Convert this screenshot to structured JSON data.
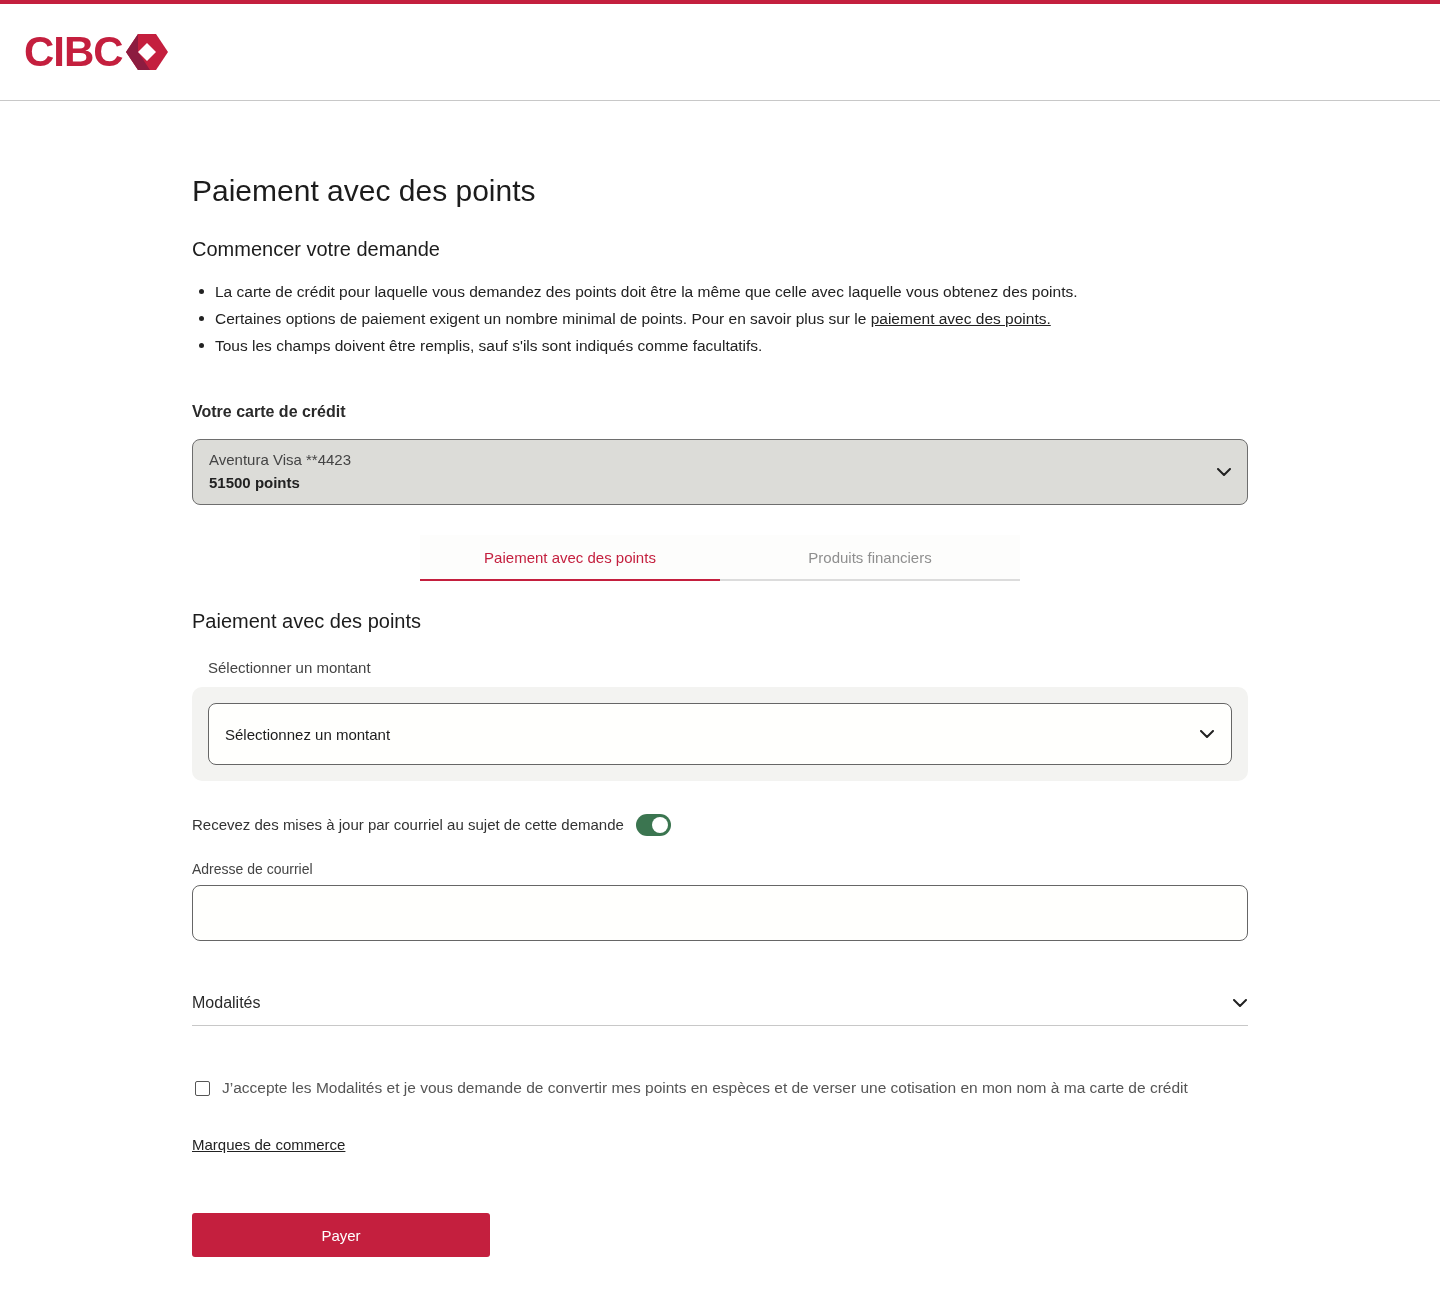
{
  "header": {
    "logo": "CIBC"
  },
  "page_title": "Paiement avec des points",
  "intro": {
    "heading": "Commencer votre demande",
    "bullets": [
      {
        "text": "La carte de crédit pour laquelle vous demandez des points doit être la même que celle avec laquelle vous obtenez des points."
      },
      {
        "text": "Certaines options de paiement exigent un nombre minimal de points. Pour en savoir plus sur le",
        "link": "paiement avec des points."
      },
      {
        "text": "Tous les champs doivent être remplis, sauf s'ils sont indiqués comme facultatifs."
      }
    ]
  },
  "card_select": {
    "label": "Votre carte de crédit",
    "card_name": "Aventura Visa **4423",
    "points": "51500 points"
  },
  "tabs": [
    {
      "label": "Paiement avec des points",
      "selected": true,
      "disabled": false
    },
    {
      "label": "Produits financiers",
      "selected": false,
      "disabled": true
    }
  ],
  "payment": {
    "heading": "Paiement avec des points",
    "amount_label": "Sélectionner un montant",
    "amount_select": {
      "placeholder": "Sélectionnez un montant"
    }
  },
  "email_updates": {
    "label": "Recevez des mises à jour par courriel au sujet de cette demande",
    "on": true
  },
  "email_field": {
    "label": "Adresse de courriel"
  },
  "terms": {
    "title": "Modalités",
    "expanded": false
  },
  "consent": {
    "label": "J’accepte les Modalités et je vous demande de convertir mes points en espèces et de verser une cotisation en mon nom à ma carte de crédit",
    "checked": false
  },
  "trademarks_link": "Marques de commerce",
  "pay_button": "Payer"
}
